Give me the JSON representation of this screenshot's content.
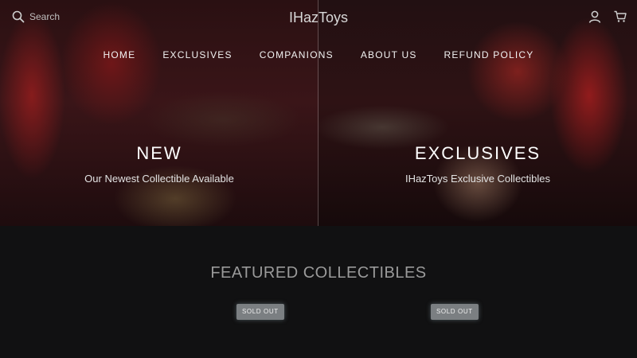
{
  "header": {
    "search": {
      "placeholder": "Search"
    },
    "logo": "IHazToys",
    "account_icon": "user-icon",
    "cart_icon": "cart-icon"
  },
  "nav": {
    "items": [
      {
        "label": "HOME"
      },
      {
        "label": "EXCLUSIVES"
      },
      {
        "label": "COMPANIONS"
      },
      {
        "label": "ABOUT US"
      },
      {
        "label": "REFUND POLICY"
      }
    ]
  },
  "hero": {
    "panels": [
      {
        "title": "NEW",
        "subtitle": "Our Newest Collectible Available"
      },
      {
        "title": "EXCLUSIVES",
        "subtitle": "IHazToys Exclusive Collectibles"
      }
    ]
  },
  "featured": {
    "title": "FEATURED COLLECTIBLES",
    "badges": [
      {
        "label": "SOLD OUT"
      },
      {
        "label": "SOLD OUT"
      }
    ]
  },
  "colors": {
    "background": "#111112",
    "badge": "#7b7f82",
    "section_title": "#9a9a9a"
  }
}
